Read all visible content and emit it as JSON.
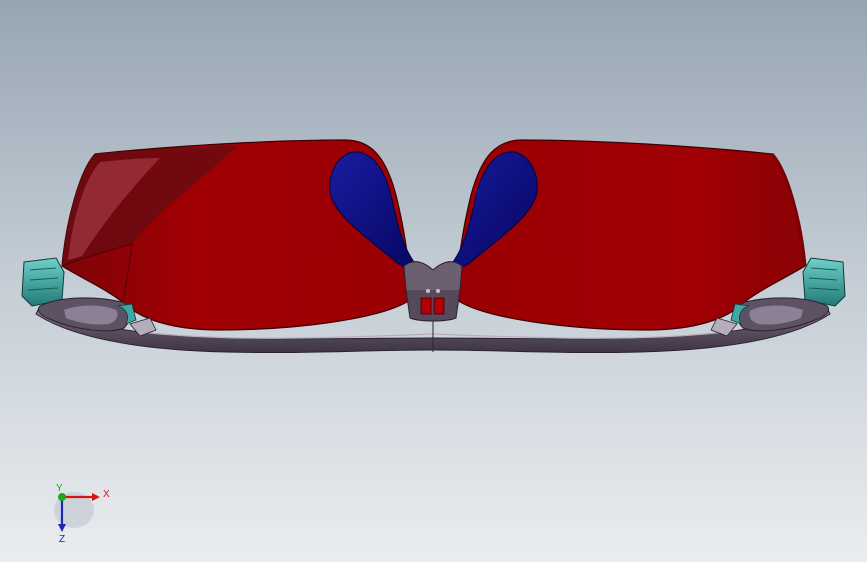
{
  "model": {
    "colors": {
      "lens": "#9c0003",
      "lens_dark": "#6b0103",
      "nose_pad": "#06077f",
      "frame": "#5a4e5c",
      "frame_light": "#8d8294",
      "hinge": "#3fa7a4",
      "background_top": "#97a5b3",
      "background_bottom": "#eaedf0"
    }
  },
  "triad": {
    "x_label": "X",
    "y_label": "Y",
    "z_label": "Z",
    "colors": {
      "x": "#d31515",
      "y": "#22a522",
      "z": "#1d28b8"
    }
  }
}
